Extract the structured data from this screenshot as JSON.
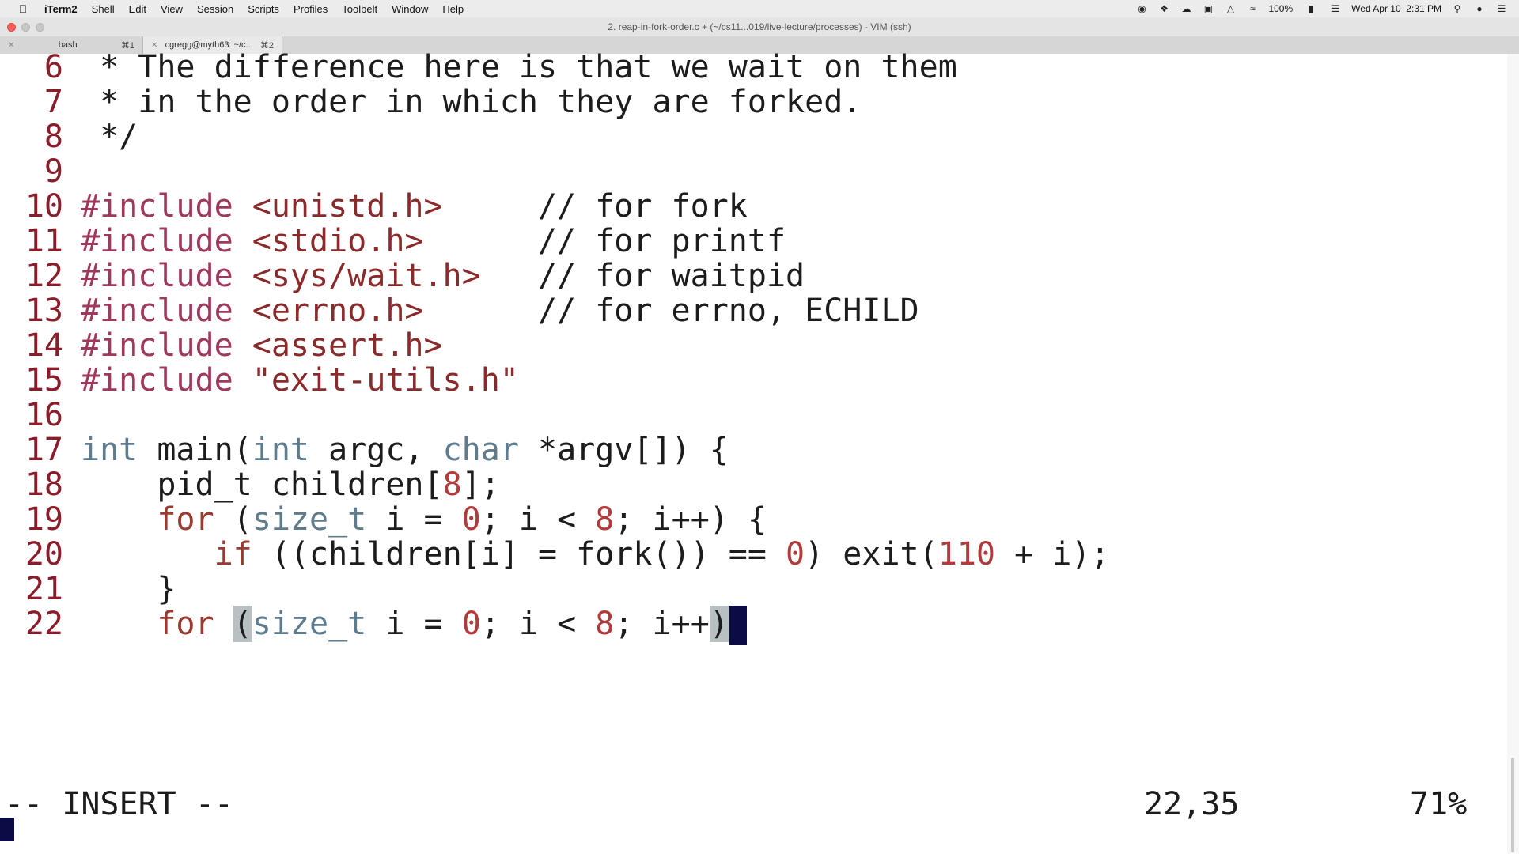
{
  "menubar": {
    "app": "iTerm2",
    "items": [
      "Shell",
      "Edit",
      "View",
      "Session",
      "Scripts",
      "Profiles",
      "Toolbelt",
      "Window",
      "Help"
    ],
    "battery": "100%",
    "datetime": "Wed Apr 10  2:31 PM"
  },
  "window": {
    "title": "2. reap-in-fork-order.c + (~/cs11...019/live-lecture/processes) - VIM (ssh)"
  },
  "tabs": [
    {
      "label": "bash",
      "shortcut": "⌘1"
    },
    {
      "label": "cgregg@myth63: ~/c...",
      "shortcut": "⌘2"
    }
  ],
  "editor": {
    "lines": [
      {
        "num": "6",
        "tokens": [
          {
            "t": " * The difference here is that we wait on them",
            "c": "plain"
          }
        ]
      },
      {
        "num": "7",
        "tokens": [
          {
            "t": " * in the order in which they are forked.",
            "c": "plain"
          }
        ]
      },
      {
        "num": "8",
        "tokens": [
          {
            "t": " */",
            "c": "plain"
          }
        ]
      },
      {
        "num": "9",
        "tokens": []
      },
      {
        "num": "10",
        "tokens": [
          {
            "t": "#include",
            "c": "pre"
          },
          {
            "t": " <unistd.h>",
            "c": "inc"
          },
          {
            "t": "     // for fork",
            "c": "plain"
          }
        ]
      },
      {
        "num": "11",
        "tokens": [
          {
            "t": "#include",
            "c": "pre"
          },
          {
            "t": " <stdio.h>",
            "c": "inc"
          },
          {
            "t": "      // for printf",
            "c": "plain"
          }
        ]
      },
      {
        "num": "12",
        "tokens": [
          {
            "t": "#include",
            "c": "pre"
          },
          {
            "t": " <sys/wait.h>",
            "c": "inc"
          },
          {
            "t": "   // for waitpid",
            "c": "plain"
          }
        ]
      },
      {
        "num": "13",
        "tokens": [
          {
            "t": "#include",
            "c": "pre"
          },
          {
            "t": " <errno.h>",
            "c": "inc"
          },
          {
            "t": "      // for errno, ECHILD",
            "c": "plain"
          }
        ]
      },
      {
        "num": "14",
        "tokens": [
          {
            "t": "#include",
            "c": "pre"
          },
          {
            "t": " <assert.h>",
            "c": "inc"
          }
        ]
      },
      {
        "num": "15",
        "tokens": [
          {
            "t": "#include",
            "c": "pre"
          },
          {
            "t": " \"exit-utils.h\"",
            "c": "inc"
          }
        ]
      },
      {
        "num": "16",
        "tokens": []
      },
      {
        "num": "17",
        "tokens": [
          {
            "t": "int",
            "c": "type"
          },
          {
            "t": " main(",
            "c": "plain"
          },
          {
            "t": "int",
            "c": "type"
          },
          {
            "t": " argc, ",
            "c": "plain"
          },
          {
            "t": "char",
            "c": "type"
          },
          {
            "t": " *argv[]) {",
            "c": "plain"
          }
        ]
      },
      {
        "num": "18",
        "tokens": [
          {
            "t": "    pid_t children[",
            "c": "plain"
          },
          {
            "t": "8",
            "c": "num"
          },
          {
            "t": "];",
            "c": "plain"
          }
        ]
      },
      {
        "num": "19",
        "tokens": [
          {
            "t": "    ",
            "c": "plain"
          },
          {
            "t": "for",
            "c": "kw"
          },
          {
            "t": " (",
            "c": "plain"
          },
          {
            "t": "size_t",
            "c": "type"
          },
          {
            "t": " i = ",
            "c": "plain"
          },
          {
            "t": "0",
            "c": "num"
          },
          {
            "t": "; i < ",
            "c": "plain"
          },
          {
            "t": "8",
            "c": "num"
          },
          {
            "t": "; i++) {",
            "c": "plain"
          }
        ]
      },
      {
        "num": "20",
        "tokens": [
          {
            "t": "       ",
            "c": "plain"
          },
          {
            "t": "if",
            "c": "kw"
          },
          {
            "t": " ((children[i] = fork()) == ",
            "c": "plain"
          },
          {
            "t": "0",
            "c": "num"
          },
          {
            "t": ") exit(",
            "c": "plain"
          },
          {
            "t": "110",
            "c": "num"
          },
          {
            "t": " + i);",
            "c": "plain"
          }
        ]
      },
      {
        "num": "21",
        "tokens": [
          {
            "t": "    }",
            "c": "plain"
          }
        ]
      },
      {
        "num": "22",
        "tokens": [
          {
            "t": "    ",
            "c": "plain"
          },
          {
            "t": "for",
            "c": "kw"
          },
          {
            "t": " ",
            "c": "plain"
          },
          {
            "t": "(",
            "c": "match"
          },
          {
            "t": "size_t",
            "c": "type"
          },
          {
            "t": " i = ",
            "c": "plain"
          },
          {
            "t": "0",
            "c": "num"
          },
          {
            "t": "; i < ",
            "c": "plain"
          },
          {
            "t": "8",
            "c": "num"
          },
          {
            "t": "; i++",
            "c": "plain"
          },
          {
            "t": ")",
            "c": "match"
          }
        ],
        "cursor": true
      }
    ]
  },
  "status": {
    "mode": "-- INSERT --",
    "position": "22,35",
    "percent": "71%"
  },
  "colors": {
    "line_number": "#8a1d2a",
    "preprocessor": "#a0375c",
    "include_path": "#8a2a2a",
    "type": "#5e7c8e",
    "keyword": "#9a3a30",
    "number": "#b23a3a",
    "cursor": "#0b0b45"
  },
  "icons": [
    "apple-icon",
    "record-icon",
    "dropbox-icon",
    "cloud-icon",
    "screen-icon",
    "airplay-icon",
    "wifi-icon",
    "battery-icon",
    "search-icon",
    "siri-icon",
    "list-icon"
  ]
}
